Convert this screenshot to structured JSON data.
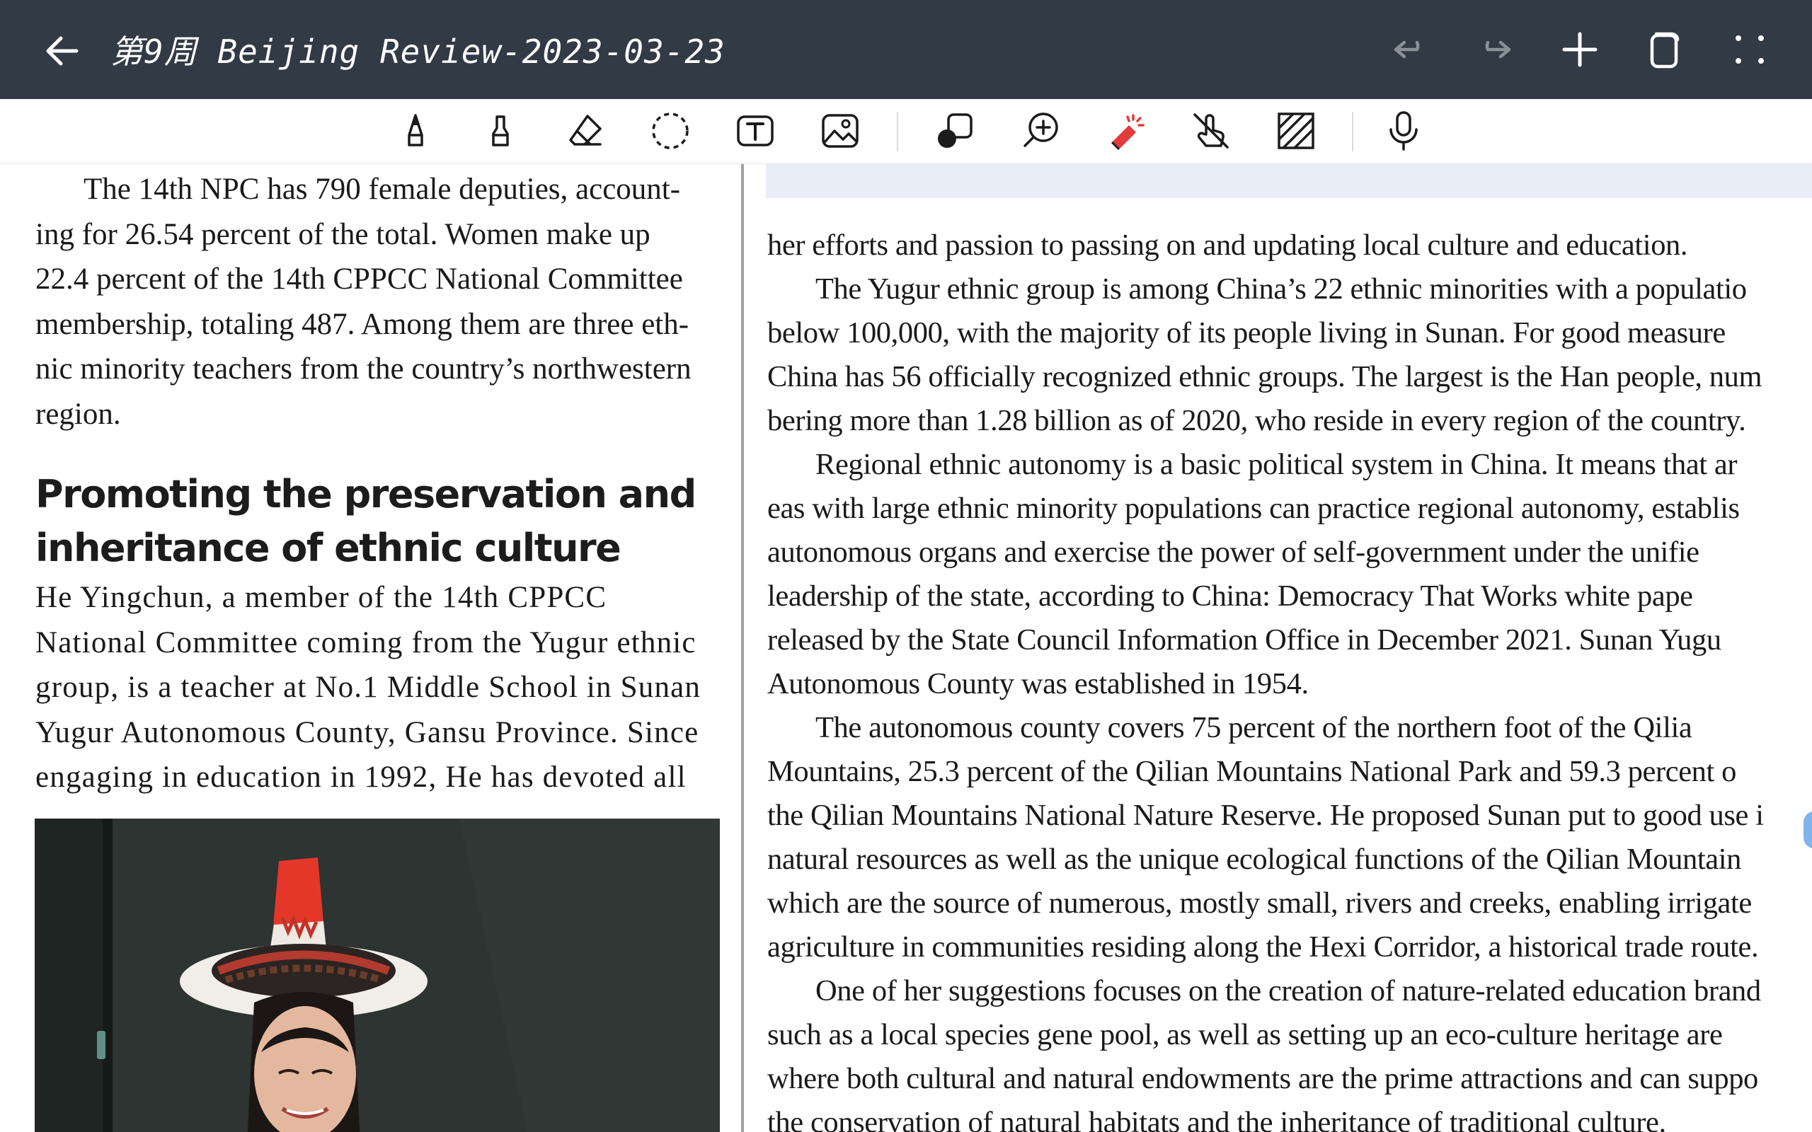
{
  "titlebar": {
    "title": "第9周 Beijing Review-2023-03-23",
    "back_icon": "arrow-left-icon",
    "actions": [
      {
        "name": "undo-button",
        "icon": "undo-icon"
      },
      {
        "name": "redo-button",
        "icon": "redo-icon"
      },
      {
        "name": "add-page-button",
        "icon": "plus-icon"
      },
      {
        "name": "copy-button",
        "icon": "copy-icon"
      },
      {
        "name": "fullscreen-button",
        "icon": "fullscreen-icon"
      }
    ]
  },
  "toolbar": {
    "tools": [
      "pen-icon",
      "highlighter-icon",
      "eraser-icon",
      "lasso-icon",
      "text-box-icon",
      "image-icon",
      "shapes-icon",
      "zoom-in-icon",
      "laser-pointer-icon",
      "touch-draw-icon",
      "pattern-icon",
      "microphone-icon"
    ]
  },
  "left_column": {
    "para1": "The 14th NPC has 790 female deputies, accounting for 26.54 percent of the total. Women make up 22.4 percent of the 14th CPPCC National Committee membership, totaling 487. Among them are three ethnic minority teachers from the country’s northwestern region.",
    "para1_lines": [
      "The 14th NPC has 790 female deputies, account-",
      "ing for 26.54 percent of the total. Women make up",
      "22.4 percent of the 14th CPPCC National Committee",
      "membership, totaling 487. Among them are three eth-",
      "nic minority teachers from the country’s northwestern",
      "region."
    ],
    "heading_line1": "Promoting the preservation and",
    "heading_line2": "inheritance of ethnic culture",
    "para2_lines": [
      "He Yingchun, a member of the 14th CPPCC",
      "National Committee coming from the Yugur ethnic",
      "group, is a teacher at No.1 Middle School in Sunan",
      "Yugur Autonomous County, Gansu Province. Since",
      "engaging in education in 1992, He has devoted all"
    ]
  },
  "right_column": {
    "lines": [
      "her efforts and passion to passing on and updating local culture and education.",
      "The Yugur ethnic group is among China’s 22 ethnic minorities with a populatio",
      "below 100,000, with the majority of its people living in Sunan. For good measure",
      "China has 56 officially recognized ethnic groups. The largest is the Han people, num",
      "bering more than 1.28 billion as of 2020, who reside in every region of the country.",
      "Regional ethnic autonomy is a basic political system in China. It means that ar",
      "eas with large ethnic minority populations can practice regional autonomy, establis",
      "autonomous organs and exercise the power of self-government under the unifie",
      "leadership of the state, according to China: Democracy That Works white pape",
      "released by the State Council Information Office in December 2021. Sunan Yugu",
      "Autonomous County was established in 1954.",
      "The autonomous county covers 75 percent of the northern foot of the Qilia",
      "Mountains, 25.3 percent of the Qilian Mountains National Park and 59.3 percent o",
      "the Qilian Mountains National Nature Reserve. He proposed Sunan put to good use i",
      "natural resources as well as the unique ecological functions of the Qilian Mountain",
      "which are the source of numerous, mostly small, rivers and creeks, enabling irrigate",
      "agriculture in communities residing along the Hexi Corridor, a historical trade route.",
      "One of her suggestions focuses on the creation of nature-related education brand",
      "such as a local species gene pool, as well as setting up an eco-culture heritage are",
      "where both cultural and natural endowments are the prime attractions and can suppo",
      "the conservation of natural habitats and the inheritance of traditional culture."
    ]
  }
}
